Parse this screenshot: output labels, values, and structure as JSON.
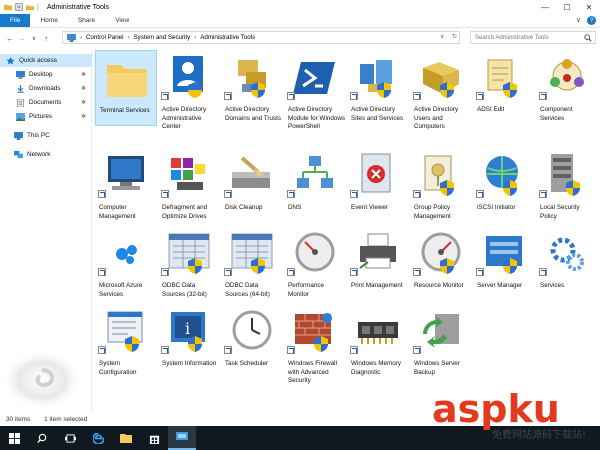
{
  "window": {
    "title": "Administrative Tools",
    "controls": {
      "minimize": "—",
      "maximize": "☐",
      "close": "✕"
    }
  },
  "ribbon": {
    "tabs": [
      "File",
      "Home",
      "Share",
      "View"
    ],
    "expand": "∨"
  },
  "nav": {
    "back": "←",
    "forward": "→",
    "up_chevron": "∨",
    "up": "↑",
    "breadcrumb": [
      "Control Panel",
      "System and Security",
      "Administrative Tools"
    ],
    "dropdown": "∨",
    "refresh": "↻",
    "search_placeholder": "Search Administrative Tools"
  },
  "sidebar": {
    "items": [
      {
        "label": "Quick access",
        "selected": true,
        "pinned": false
      },
      {
        "label": "Desktop",
        "selected": false,
        "pinned": true
      },
      {
        "label": "Downloads",
        "selected": false,
        "pinned": true
      },
      {
        "label": "Documents",
        "selected": false,
        "pinned": true
      },
      {
        "label": "Pictures",
        "selected": false,
        "pinned": true
      },
      {
        "label": "This PC",
        "selected": false,
        "pinned": false
      },
      {
        "label": "Network",
        "selected": false,
        "pinned": false
      }
    ],
    "pin_glyph": "✱"
  },
  "items": [
    {
      "label": "Terminal Services",
      "icon": "folder-icon",
      "selected": true,
      "shield": false
    },
    {
      "label": "Active Directory Administrative Center",
      "icon": "ad-admin-center-icon",
      "shield": true
    },
    {
      "label": "Active Directory Domains and Trusts",
      "icon": "ad-domains-icon",
      "shield": true
    },
    {
      "label": "Active Directory Module for Windows PowerShell",
      "icon": "powershell-icon",
      "shield": false
    },
    {
      "label": "Active Directory Sites and Services",
      "icon": "ad-sites-icon",
      "shield": true
    },
    {
      "label": "Active Directory Users and Computers",
      "icon": "ad-users-icon",
      "shield": true
    },
    {
      "label": "ADSI Edit",
      "icon": "adsi-edit-icon",
      "shield": true
    },
    {
      "label": "Component Services",
      "icon": "component-services-icon",
      "shield": false
    },
    {
      "label": "Computer Management",
      "icon": "computer-management-icon",
      "shield": false
    },
    {
      "label": "Defragment and Optimize Drives",
      "icon": "defrag-icon",
      "shield": false
    },
    {
      "label": "Disk Cleanup",
      "icon": "disk-cleanup-icon",
      "shield": false
    },
    {
      "label": "DNS",
      "icon": "dns-icon",
      "shield": false
    },
    {
      "label": "Event Viewer",
      "icon": "event-viewer-icon",
      "shield": false
    },
    {
      "label": "Group Policy Management",
      "icon": "group-policy-icon",
      "shield": true
    },
    {
      "label": "iSCSI Initiator",
      "icon": "iscsi-icon",
      "shield": true
    },
    {
      "label": "Local Security Policy",
      "icon": "local-security-icon",
      "shield": true
    },
    {
      "label": "Microsoft Azure Services",
      "icon": "azure-icon",
      "shield": false
    },
    {
      "label": "ODBC Data Sources (32-bit)",
      "icon": "odbc32-icon",
      "shield": true
    },
    {
      "label": "ODBC Data Sources (64-bit)",
      "icon": "odbc64-icon",
      "shield": true
    },
    {
      "label": "Performance Monitor",
      "icon": "performance-monitor-icon",
      "shield": false
    },
    {
      "label": "Print Management",
      "icon": "print-management-icon",
      "shield": false
    },
    {
      "label": "Resource Monitor",
      "icon": "resource-monitor-icon",
      "shield": true
    },
    {
      "label": "Server Manager",
      "icon": "server-manager-icon",
      "shield": true
    },
    {
      "label": "Services",
      "icon": "services-icon",
      "shield": false
    },
    {
      "label": "System Configuration",
      "icon": "system-configuration-icon",
      "shield": true
    },
    {
      "label": "System Information",
      "icon": "system-information-icon",
      "shield": true
    },
    {
      "label": "Task Scheduler",
      "icon": "task-scheduler-icon",
      "shield": false
    },
    {
      "label": "Windows Firewall with Advanced Security",
      "icon": "firewall-icon",
      "shield": true
    },
    {
      "label": "Windows Memory Diagnostic",
      "icon": "memory-diagnostic-icon",
      "shield": false
    },
    {
      "label": "Windows Server Backup",
      "icon": "server-backup-icon",
      "shield": false
    }
  ],
  "status": {
    "count": "30 items",
    "selection": "1 item selected"
  },
  "watermark": {
    "brand": "aspku",
    "sub": "免费网站源码下载站!"
  },
  "colors": {
    "accent": "#1979ca",
    "selection": "#cce8ff",
    "taskbar": "#101820",
    "watermark_red": "#e33a1e"
  }
}
